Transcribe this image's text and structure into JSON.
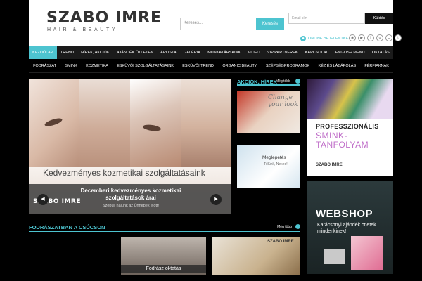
{
  "header": {
    "logo_name": "SZABO IMRE",
    "logo_tag": "HAIR & BEAUTY",
    "search_placeholder": "Keresés...",
    "search_button": "Keresés",
    "email_placeholder": "Email cím",
    "send_button": "Küldés",
    "newsletter_label": "ONLINE BEJELENTKEZÉS",
    "socials": [
      "rss-icon",
      "youtube-icon",
      "facebook-icon",
      "google-plus-icon",
      "instagram-icon",
      "twitter-icon"
    ]
  },
  "nav_primary": [
    "KEZDŐLAP",
    "TREND",
    "HÍREK, AKCIÓK",
    "AJÁNDÉK ÖTLETEK",
    "ÁRLISTA",
    "GALÉRIA",
    "MUNKATÁRSAINK",
    "VIDEO",
    "VIP PARTNEREK",
    "KAPCSOLAT",
    "ENGLISH MENU",
    "OKTATÁS"
  ],
  "nav_secondary": [
    "FODRÁSZAT",
    "SMINK",
    "KOZMETIKA",
    "ESKÜVŐI SZOLGÁLTATÁSAINK",
    "ESKÜVŐI TREND",
    "ORGANIC BEAUTY",
    "SZÉPSÉGPROGRAMOK",
    "KÉZ ÉS LÁBÁPOLÁS",
    "FÉRFIAKNAK"
  ],
  "slider": {
    "headline": "Kedvezményes kozmetikai szolgáltatásaink",
    "caption_title": "Decemberi kedvezményes kozmetikai szolgáltatások árai",
    "caption_sub": "Szépülj nálunk az Ünnepek előtt!",
    "logo": "SZABO IMRE",
    "prev": "◀",
    "next": "▶"
  },
  "news": {
    "title": "AKCIÓK, HÍREK",
    "more": "Még több",
    "card1_text": "Change your look",
    "card2_title": "Meglepetés",
    "card2_sub": "Tőlünk, Neked!"
  },
  "ads": {
    "ad1_pro": "PROFESSZIONÁLIS",
    "ad1_smink": "SMINK-TANFOLYAM",
    "ad1_logo": "SZABO IMRE",
    "ad2_title": "WEBSHOP",
    "ad2_sub": "Karácsonyi ajándék ötletek mindenkinek!"
  },
  "bottom": {
    "title": "FODRÁSZATBAN A CSÚCSON",
    "more": "Még több",
    "thumb1_label": "Fodrász oktatás",
    "thumb2_logo": "SZABO IMRE"
  },
  "colors": {
    "accent": "#4dc4d0",
    "background": "#000000",
    "nav": "#1b1b1b"
  }
}
